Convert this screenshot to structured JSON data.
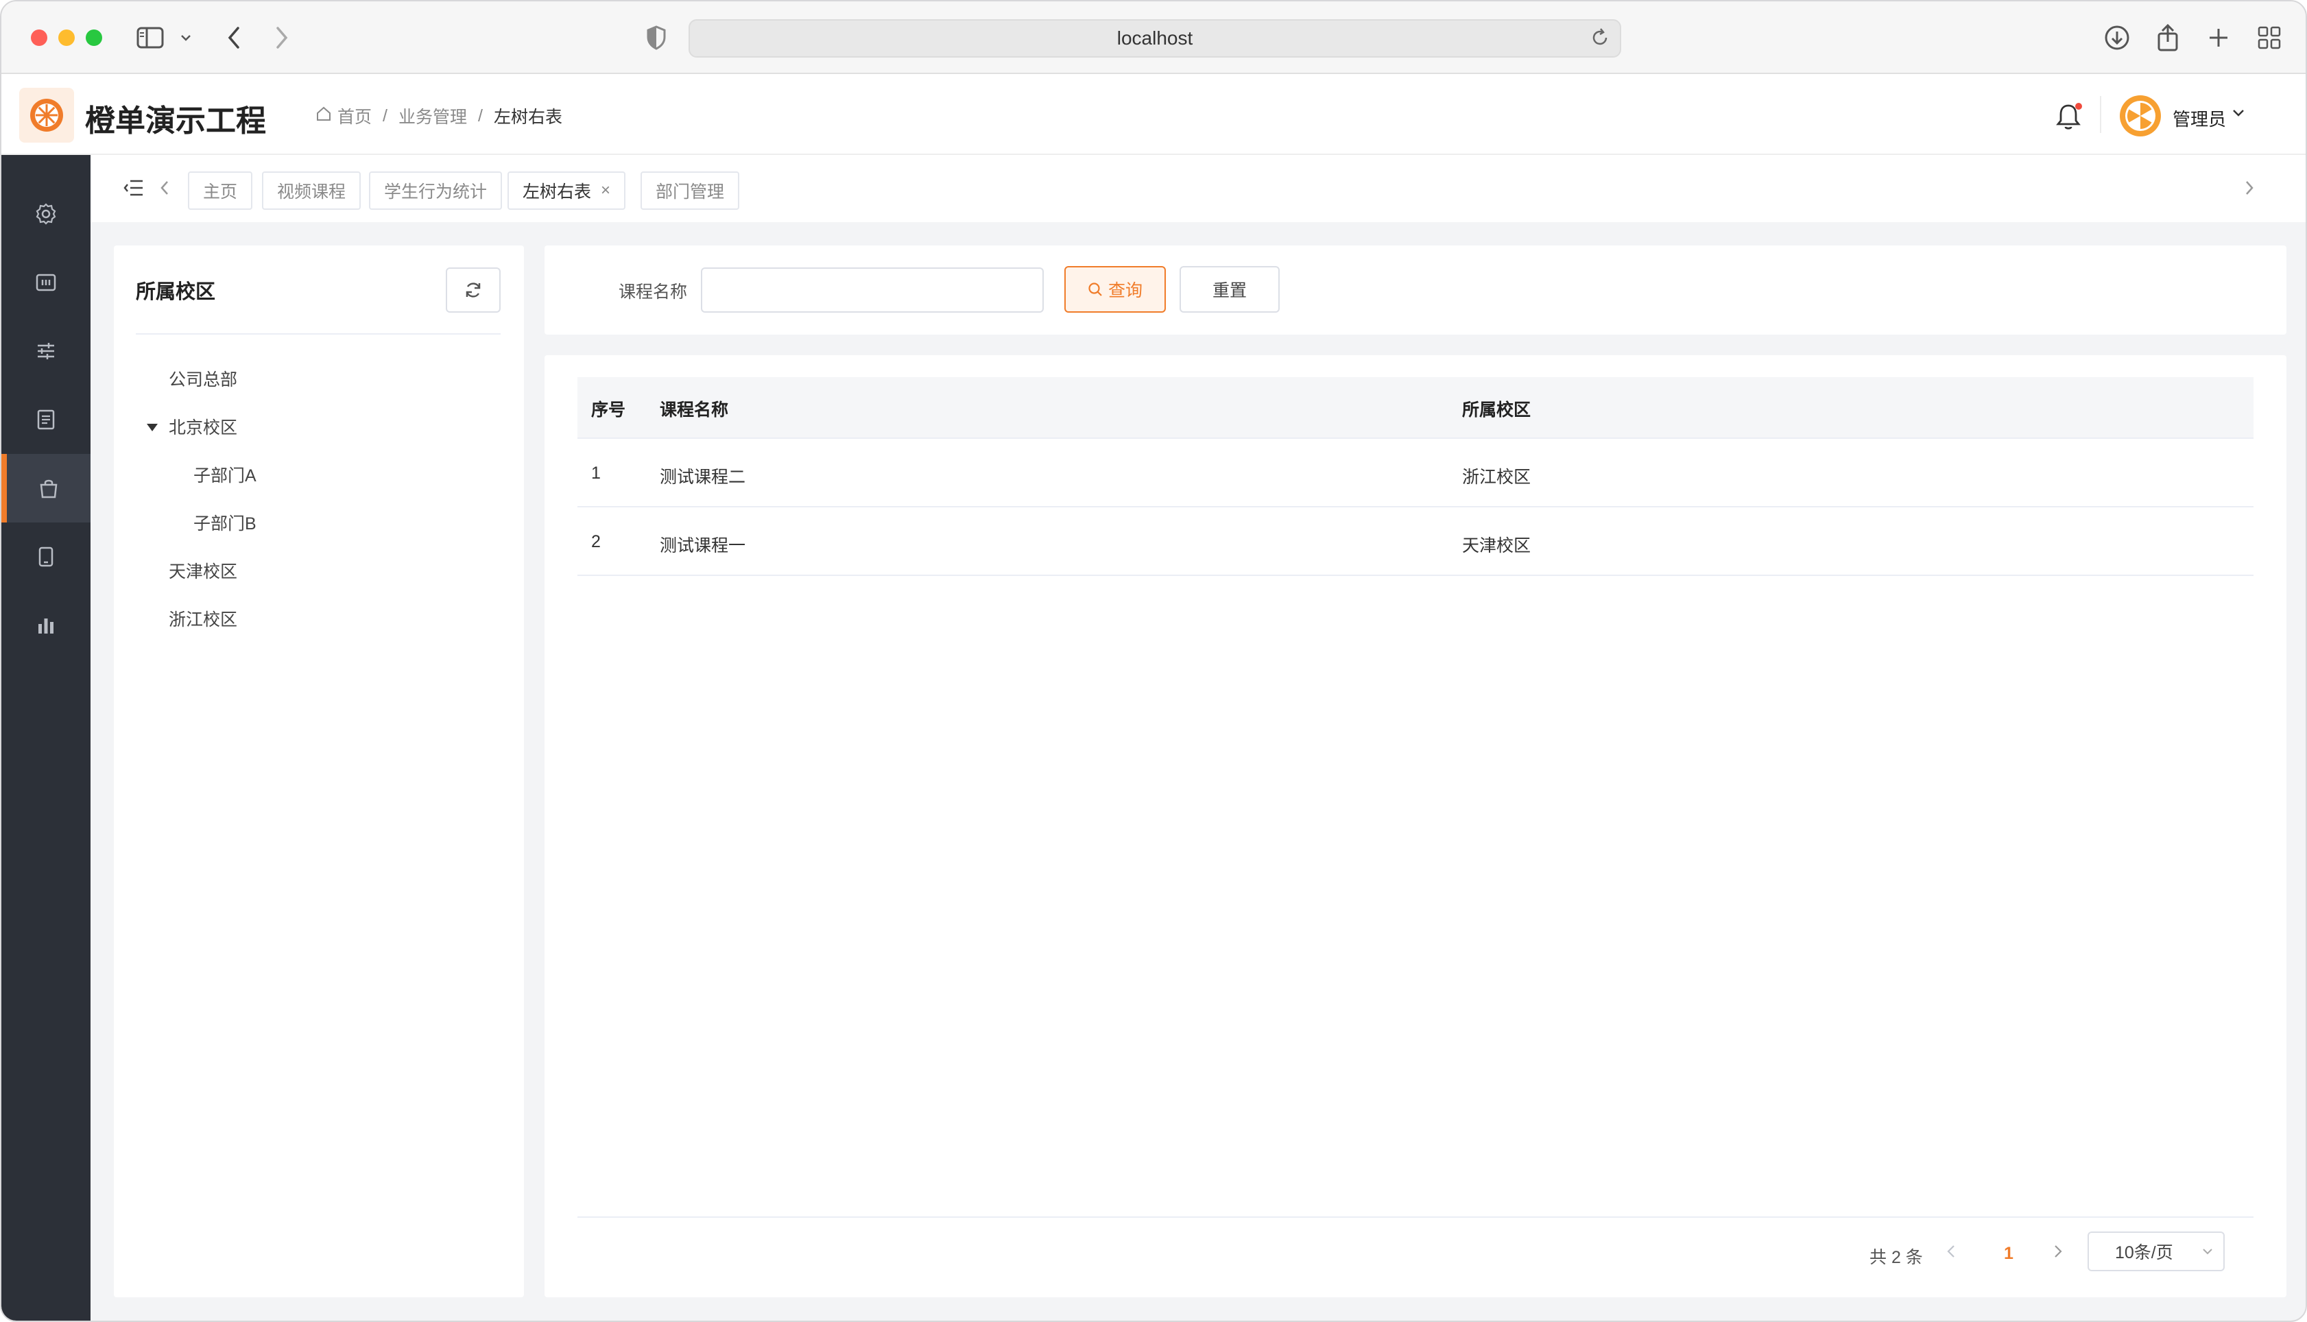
{
  "browser": {
    "url": "localhost"
  },
  "header": {
    "app_title": "橙单演示工程",
    "breadcrumb": [
      "首页",
      "业务管理",
      "左树右表"
    ],
    "breadcrumb_sep": "/",
    "user_name": "管理员",
    "has_notification": true
  },
  "sidebar": {
    "items": [
      {
        "icon": "gear-icon",
        "active": false
      },
      {
        "icon": "dashboard-icon",
        "active": false
      },
      {
        "icon": "sliders-icon",
        "active": false
      },
      {
        "icon": "document-icon",
        "active": false
      },
      {
        "icon": "shopping-bag-icon",
        "active": true
      },
      {
        "icon": "tablet-icon",
        "active": false
      },
      {
        "icon": "bar-chart-icon",
        "active": false
      }
    ]
  },
  "tabs": {
    "items": [
      {
        "label": "主页",
        "active": false,
        "closable": false
      },
      {
        "label": "视频课程",
        "active": false,
        "closable": false
      },
      {
        "label": "学生行为统计",
        "active": false,
        "closable": false
      },
      {
        "label": "左树右表",
        "active": true,
        "closable": true
      },
      {
        "label": "部门管理",
        "active": false,
        "closable": false
      }
    ],
    "close_glyph": "×"
  },
  "tree": {
    "title": "所属校区",
    "nodes": [
      {
        "label": "公司总部",
        "level": 0,
        "expanded": false
      },
      {
        "label": "北京校区",
        "level": 0,
        "expanded": true
      },
      {
        "label": "子部门A",
        "level": 1,
        "expanded": false
      },
      {
        "label": "子部门B",
        "level": 1,
        "expanded": false
      },
      {
        "label": "天津校区",
        "level": 0,
        "expanded": false
      },
      {
        "label": "浙江校区",
        "level": 0,
        "expanded": false
      }
    ]
  },
  "search": {
    "label": "课程名称",
    "value": "",
    "placeholder": "",
    "query_label": "查询",
    "reset_label": "重置"
  },
  "table": {
    "columns": [
      "序号",
      "课程名称",
      "所属校区"
    ],
    "rows": [
      [
        "1",
        "测试课程二",
        "浙江校区"
      ],
      [
        "2",
        "测试课程一",
        "天津校区"
      ]
    ]
  },
  "pagination": {
    "total_text": "共 2 条",
    "current_page": "1",
    "page_size": "10条/页"
  },
  "colors": {
    "accent": "#f07c2a",
    "sidebar_bg": "#2c3038"
  }
}
